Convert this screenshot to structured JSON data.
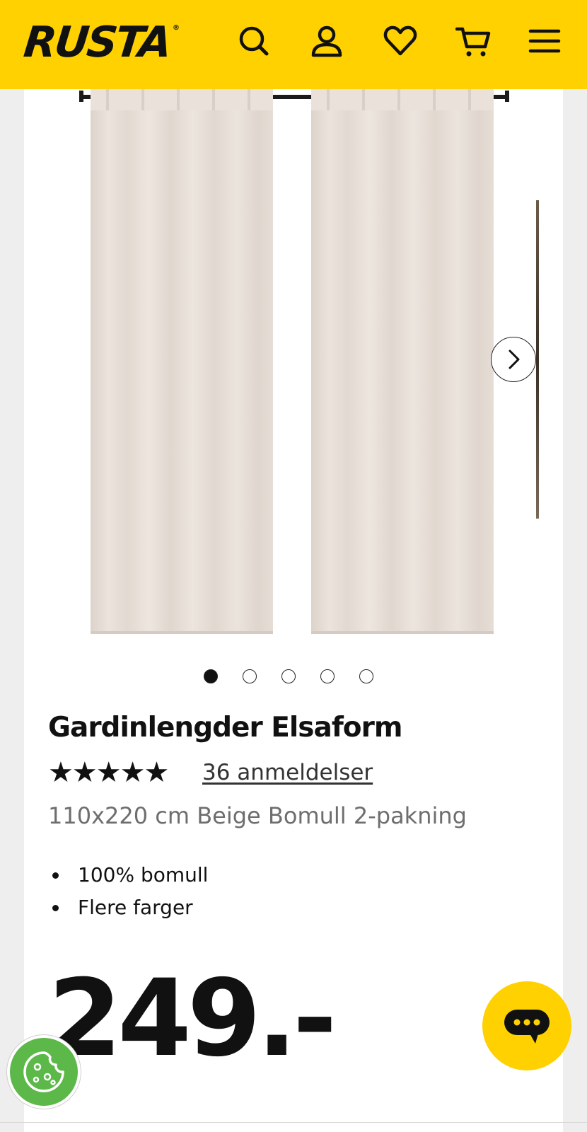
{
  "header": {
    "logo": "RUSTA",
    "logo_mark": "®",
    "background": "#ffd100",
    "icons": [
      "search-icon",
      "account-icon",
      "heart-icon",
      "cart-icon",
      "menu-icon"
    ]
  },
  "gallery": {
    "slide_count": 5,
    "active_slide": 1,
    "next_icon": "chevron-right-icon"
  },
  "product": {
    "title": "Gardinlengder Elsaform",
    "stars": "★★★★★",
    "rating": 5,
    "reviews_label": "36 anmeldelser",
    "subtitle": "110x220 cm Beige Bomull 2-pakning",
    "features": [
      "100% bomull",
      "Flere farger"
    ],
    "price": "249.-"
  },
  "floating": {
    "chat_icon": "chat-bubble-icon",
    "cookie_icon": "cookie-icon",
    "chat_color": "#ffd100",
    "cookie_color": "#5cb848"
  }
}
